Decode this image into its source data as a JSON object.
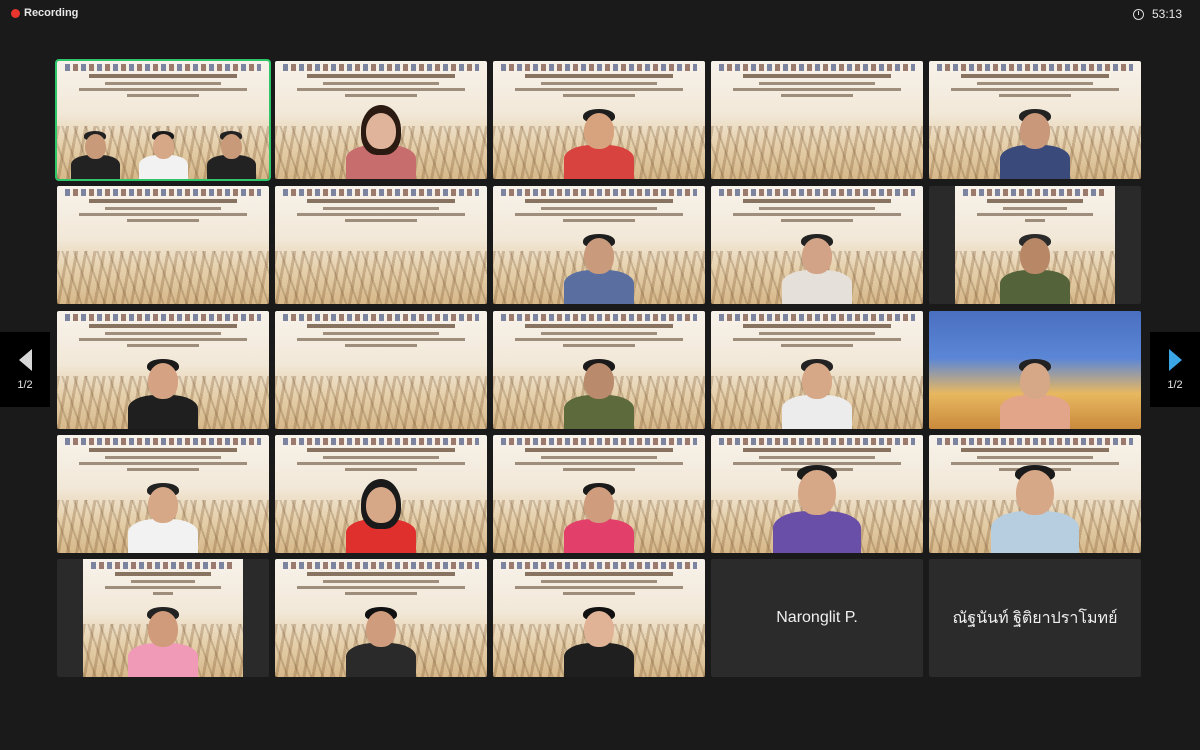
{
  "topbar": {
    "recording_label": "Recording",
    "timer": "53:13"
  },
  "pagination": {
    "left_label": "1/2",
    "right_label": "1/2"
  },
  "participants": [
    {
      "id": "p01",
      "name": "",
      "kind": "slide",
      "active": true
    },
    {
      "id": "p02",
      "name": "",
      "kind": "slide"
    },
    {
      "id": "p03",
      "name": "",
      "kind": "slide"
    },
    {
      "id": "p04",
      "name": "",
      "kind": "slide"
    },
    {
      "id": "p05",
      "name": "",
      "kind": "slide"
    },
    {
      "id": "p06",
      "name": "",
      "kind": "slide"
    },
    {
      "id": "p07",
      "name": "",
      "kind": "slide"
    },
    {
      "id": "p08",
      "name": "",
      "kind": "slide"
    },
    {
      "id": "p09",
      "name": "",
      "kind": "slide"
    },
    {
      "id": "p10",
      "name": "",
      "kind": "slide"
    },
    {
      "id": "p11",
      "name": "",
      "kind": "slide"
    },
    {
      "id": "p12",
      "name": "",
      "kind": "slide"
    },
    {
      "id": "p13",
      "name": "",
      "kind": "slide"
    },
    {
      "id": "p14",
      "name": "",
      "kind": "slide"
    },
    {
      "id": "p15",
      "name": "",
      "kind": "temple"
    },
    {
      "id": "p16",
      "name": "",
      "kind": "slide"
    },
    {
      "id": "p17",
      "name": "",
      "kind": "slide"
    },
    {
      "id": "p18",
      "name": "",
      "kind": "slide"
    },
    {
      "id": "p19",
      "name": "",
      "kind": "slide"
    },
    {
      "id": "p20",
      "name": "",
      "kind": "slide"
    },
    {
      "id": "p21",
      "name": "",
      "kind": "slide"
    },
    {
      "id": "p22",
      "name": "",
      "kind": "slide"
    },
    {
      "id": "p23",
      "name": "",
      "kind": "slide"
    },
    {
      "id": "p24",
      "name": "Naronglit P.",
      "kind": "name"
    },
    {
      "id": "p25",
      "name": "ณัฐนันท์ ฐิติยาปราโมทย์",
      "kind": "name"
    }
  ]
}
